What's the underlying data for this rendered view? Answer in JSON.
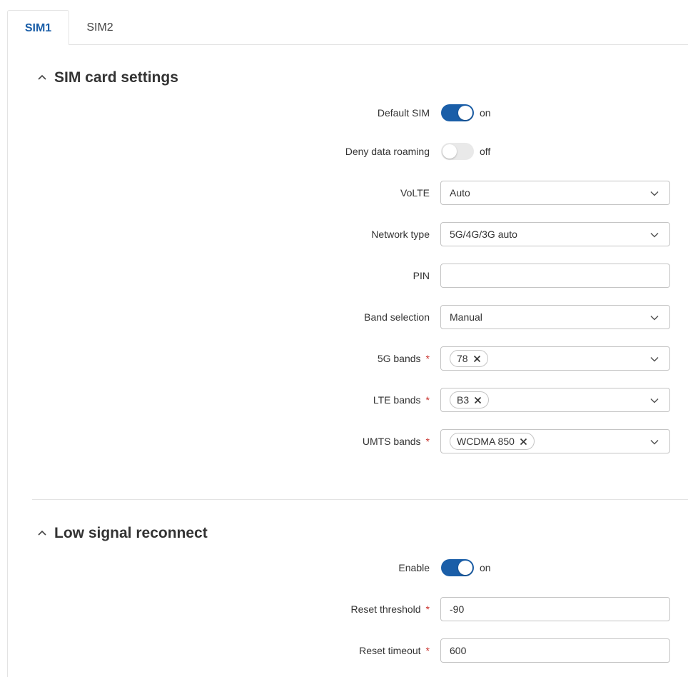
{
  "tabs": [
    {
      "label": "SIM1",
      "active": true
    },
    {
      "label": "SIM2",
      "active": false
    }
  ],
  "sections": {
    "sim_card_settings": {
      "title": "SIM card settings"
    },
    "low_signal_reconnect": {
      "title": "Low signal reconnect"
    }
  },
  "fields": {
    "default_sim": {
      "label": "Default SIM",
      "state": "on"
    },
    "deny_data_roaming": {
      "label": "Deny data roaming",
      "state": "off"
    },
    "volte": {
      "label": "VoLTE",
      "value": "Auto"
    },
    "network_type": {
      "label": "Network type",
      "value": "5G/4G/3G auto"
    },
    "pin": {
      "label": "PIN",
      "value": ""
    },
    "band_selection": {
      "label": "Band selection",
      "value": "Manual"
    },
    "bands_5g": {
      "label": "5G bands",
      "required": "*",
      "chips": [
        "78"
      ]
    },
    "lte_bands": {
      "label": "LTE bands",
      "required": "*",
      "chips": [
        "B3"
      ]
    },
    "umts_bands": {
      "label": "UMTS bands",
      "required": "*",
      "chips": [
        "WCDMA 850"
      ]
    },
    "enable": {
      "label": "Enable",
      "state": "on"
    },
    "reset_threshold": {
      "label": "Reset threshold",
      "required": "*",
      "value": "-90"
    },
    "reset_timeout": {
      "label": "Reset timeout",
      "required": "*",
      "value": "600"
    }
  },
  "colors": {
    "accent": "#1a5ea8",
    "required": "#c9302c",
    "border": "#c4c4c4"
  }
}
